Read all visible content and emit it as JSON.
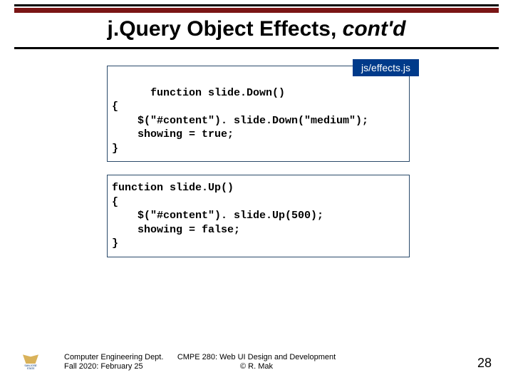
{
  "title_main": "j.Query Object Effects, ",
  "title_italic": "cont'd",
  "file_tag": "js/effects.js",
  "code_block_1": "function slide.Down()\n{\n    $(\"#content\"). slide.Down(\"medium\");\n    showing = true;\n}",
  "code_block_2": "function slide.Up()\n{\n    $(\"#content\"). slide.Up(500);\n    showing = false;\n}",
  "footer_dept_line1": "Computer Engineering Dept.",
  "footer_dept_line2": "Fall 2020: February 25",
  "footer_center_line1": "CMPE 280: Web UI Design and Development",
  "footer_center_line2": "© R. Mak",
  "page_number": "28",
  "logo_label": "SAN JOSE STATE"
}
